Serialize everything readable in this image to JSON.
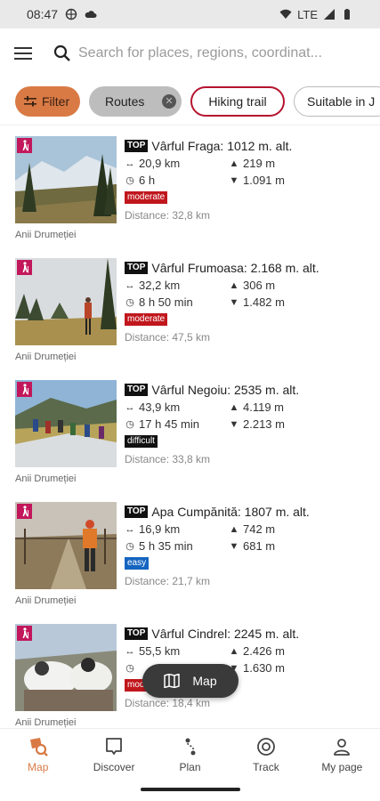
{
  "status_bar": {
    "time": "08:47",
    "network": "LTE"
  },
  "search": {
    "placeholder": "Search for places, regions, coordinat..."
  },
  "filters": {
    "filter_label": "Filter",
    "routes_label": "Routes",
    "hiking_label": "Hiking trail",
    "suitable_label": "Suitable in J"
  },
  "colors": {
    "accent": "#d97a45",
    "moderate": "#c0171d",
    "difficult": "#111111",
    "easy": "#1565c0",
    "hike_badge": "#c2185b"
  },
  "routes": [
    {
      "badge": "TOP",
      "title": "Vârful Fraga: 1012 m. alt.",
      "distance": "20,9 km",
      "ascent": "219 m",
      "duration": "6 h",
      "descent": "1.091 m",
      "difficulty": "moderate",
      "difficulty_color": "#c0171d",
      "from_you": "Distance: 32,8 km",
      "author": "Anii Drumeției"
    },
    {
      "badge": "TOP",
      "title": "Vârful Frumoasa: 2.168 m. alt.",
      "distance": "32,2 km",
      "ascent": "306 m",
      "duration": "8 h 50 min",
      "descent": "1.482 m",
      "difficulty": "moderate",
      "difficulty_color": "#c0171d",
      "from_you": "Distance: 47,5 km",
      "author": "Anii Drumeției"
    },
    {
      "badge": "TOP",
      "title": "Vârful Negoiu: 2535 m. alt.",
      "distance": "43,9 km",
      "ascent": "4.119 m",
      "duration": "17 h 45 min",
      "descent": "2.213 m",
      "difficulty": "difficult",
      "difficulty_color": "#111111",
      "from_you": "Distance: 33,8 km",
      "author": "Anii Drumeției"
    },
    {
      "badge": "TOP",
      "title": "Apa Cumpănită: 1807 m. alt.",
      "distance": "16,9 km",
      "ascent": "742 m",
      "duration": "5 h 35 min",
      "descent": "681 m",
      "difficulty": "easy",
      "difficulty_color": "#1565c0",
      "from_you": "Distance: 21,7 km",
      "author": "Anii Drumeției"
    },
    {
      "badge": "TOP",
      "title": "Vârful Cindrel: 2245 m. alt.",
      "distance": "55,5 km",
      "ascent": "2.426 m",
      "duration": "",
      "descent": "1.630 m",
      "difficulty": "moderate",
      "difficulty_color": "#c0171d",
      "from_you": "Distance: 18,4 km",
      "author": "Anii Drumeției"
    }
  ],
  "map_button": {
    "label": "Map"
  },
  "nav": [
    {
      "label": "Map",
      "icon": "map-search-icon",
      "active": true
    },
    {
      "label": "Discover",
      "icon": "discover-icon",
      "active": false
    },
    {
      "label": "Plan",
      "icon": "plan-route-icon",
      "active": false
    },
    {
      "label": "Track",
      "icon": "track-record-icon",
      "active": false
    },
    {
      "label": "My page",
      "icon": "profile-icon",
      "active": false
    }
  ]
}
